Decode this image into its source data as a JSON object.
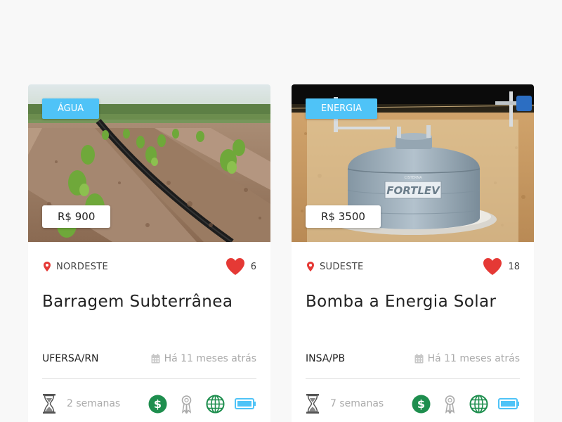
{
  "cards": [
    {
      "category": "ÁGUA",
      "price": "R$ 900",
      "image": "drip-irrigation-seedlings",
      "region": "NORDESTE",
      "likes": "6",
      "title": "Barragem Subterrânea",
      "institution": "UFERSA/RN",
      "posted": "Há 11 meses atrás",
      "duration": "2 semanas",
      "icons": [
        "location-pin-icon",
        "heart-icon",
        "calendar-icon",
        "hourglass-icon",
        "dollar-icon",
        "award-ribbon-icon",
        "globe-icon",
        "battery-icon"
      ]
    },
    {
      "category": "ENERGIA",
      "price": "R$ 3500",
      "image": "underground-water-cistern-tank",
      "tank_brand": "FORTLEV",
      "tank_subtext": "CISTERNA",
      "region": "SUDESTE",
      "likes": "18",
      "title": "Bomba a Energia Solar",
      "institution": "INSA/PB",
      "posted": "Há 11 meses atrás",
      "duration": "7 semanas",
      "icons": [
        "location-pin-icon",
        "heart-icon",
        "calendar-icon",
        "hourglass-icon",
        "dollar-icon",
        "award-ribbon-icon",
        "globe-icon",
        "battery-icon"
      ]
    }
  ],
  "colors": {
    "page_background": "#f8f8f8",
    "badge": "#4fc3f7",
    "heart": "#e53935",
    "pin": "#e53935",
    "dollar": "#1e8e4e",
    "globe": "#1e8e4e",
    "battery": "#4fc3f7",
    "muted_text": "#aaaaaa"
  }
}
